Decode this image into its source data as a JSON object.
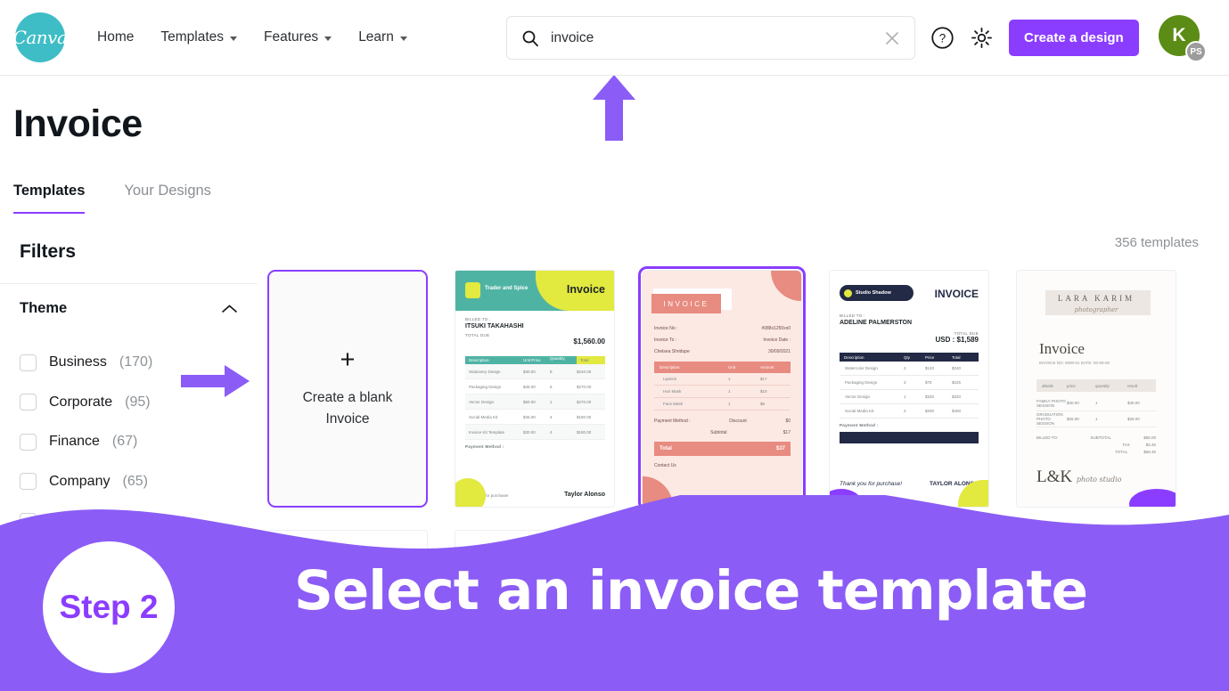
{
  "header": {
    "logo_text": "Canva",
    "nav": [
      {
        "label": "Home",
        "has_caret": false
      },
      {
        "label": "Templates",
        "has_caret": true
      },
      {
        "label": "Features",
        "has_caret": true
      },
      {
        "label": "Learn",
        "has_caret": true
      }
    ],
    "search": {
      "value": "invoice",
      "placeholder": "Search"
    },
    "cta_label": "Create a design",
    "avatar": {
      "initial": "K",
      "badge": "PS"
    },
    "accent_purple": "#8b3dff",
    "logo_teal": "#3ebdc6"
  },
  "page": {
    "title": "Invoice",
    "tabs": [
      {
        "label": "Templates",
        "active": true
      },
      {
        "label": "Your Designs",
        "active": false
      }
    ],
    "result_count": "356 templates"
  },
  "sidebar": {
    "filters_title": "Filters",
    "group_label": "Theme",
    "items": [
      {
        "label": "Business",
        "count": "(170)"
      },
      {
        "label": "Corporate",
        "count": "(95)"
      },
      {
        "label": "Finance",
        "count": "(67)"
      },
      {
        "label": "Company",
        "count": "(65)"
      },
      {
        "label": "",
        "count": ""
      }
    ]
  },
  "grid": {
    "blank_card": {
      "plus": "+",
      "line1": "Create a blank",
      "line2": "Invoice"
    },
    "templates": [
      {
        "id": "trader-and-spice",
        "title": "Invoice",
        "brand": "Trader and Spice",
        "billed_to_label": "BILLED TO :",
        "client": "ITSUKI TAKAHASHI",
        "total_label": "TOTAL DUE",
        "total": "$1,560.00",
        "columns": [
          "Description",
          "Unit Price",
          "Quantity",
          "Total"
        ],
        "rows": [
          {
            "desc": "Stationery Design",
            "price": "$30.00",
            "qty": "8",
            "amount": "$240.00"
          },
          {
            "desc": "Packaging Design",
            "price": "$45.00",
            "qty": "6",
            "amount": "$270.00"
          },
          {
            "desc": "Vector Design",
            "price": "$60.00",
            "qty": "1",
            "amount": "$270.00"
          },
          {
            "desc": "Social Media Kit",
            "price": "$45.00",
            "qty": "4",
            "amount": "$180.00"
          },
          {
            "desc": "Invoice Kit Template",
            "price": "$30.00",
            "qty": "4",
            "amount": "$180.00"
          }
        ],
        "payment_label": "Payment Method :",
        "footer_note": "Thank you for purchase!",
        "signature": "Taylor Alonso"
      },
      {
        "id": "pink-invoice",
        "title": "INVOICE",
        "selected": true,
        "invoice_no_label": "Invoice No :",
        "invoice_no": "#088x1250xx0",
        "invoice_to_label": "Invoice To :",
        "client": "Chelsea Shridupe",
        "invoice_date_label": "Invoice Date :",
        "invoice_date": "30/09/2021",
        "columns": [
          "Description",
          "Unit",
          "Amount"
        ],
        "rows": [
          {
            "desc": "Lipstick",
            "unit": "1",
            "amount": "$17"
          },
          {
            "desc": "Hair Mask",
            "unit": "1",
            "amount": "$10"
          },
          {
            "desc": "Face Mask",
            "unit": "1",
            "amount": "$8"
          }
        ],
        "discount_label": "Discount",
        "discount": "$0",
        "subtotal_label": "Subtotal",
        "subtotal": "$17",
        "total_label": "Total",
        "total": "$37",
        "payment_label": "Payment Method :",
        "contact_label": "Contact Us"
      },
      {
        "id": "studio-shadow",
        "title": "INVOICE",
        "brand": "Studio Shadow",
        "billed_to_label": "BILLED TO :",
        "client": "ADELINE PALMERSTON",
        "total_label": "TOTAL DUE",
        "total": "USD : $1,589",
        "columns": [
          "Description",
          "Qty",
          "Price",
          "Total"
        ],
        "rows": [
          {
            "desc": "Watercolor Design",
            "qty": "2",
            "price": "$120",
            "amount": "$240"
          },
          {
            "desc": "Packaging Design",
            "qty": "3",
            "price": "$75",
            "amount": "$225"
          },
          {
            "desc": "Vector Design",
            "qty": "1",
            "price": "$320",
            "amount": "$320"
          },
          {
            "desc": "Social Media Kit",
            "qty": "2",
            "price": "$200",
            "amount": "$400"
          }
        ],
        "payment_label": "Payment Method :",
        "footer_note": "Thank you for purchase!",
        "signature": "TAYLOR ALONSO"
      },
      {
        "id": "lara-karim",
        "brand": "LARA KARIM",
        "brand_sub": "photographer",
        "title": "Invoice",
        "meta": "INVOICE NO: 0000-01  DATE: 00-00-00",
        "columns": [
          "details",
          "price",
          "quantity",
          "result"
        ],
        "rows": [
          {
            "desc": "FAMILY PHOTO SESSION",
            "price": "$40.00",
            "qty": "1",
            "amount": "$40.00"
          },
          {
            "desc": "GRADUATION PHOTO SESSION",
            "price": "$25.00",
            "qty": "1",
            "amount": "$25.00"
          }
        ],
        "billed_label": "BILLED TO:",
        "subtotal_label": "SUBTOTAL",
        "subtotal": "$65.00",
        "tax_label": "TAX",
        "tax": "$3.45",
        "total_label": "TOTAL",
        "total": "$68.45",
        "footer_logo": "L&K",
        "footer_sub": "photo studio"
      }
    ]
  },
  "banner": {
    "step": "Step 2",
    "text": "Select an invoice template",
    "color": "#8b5cf6"
  },
  "annotations": {
    "arrow_up_name": "arrow pointing to search bar",
    "arrow_right_name": "arrow pointing to template grid",
    "color": "#8b5cf6"
  }
}
